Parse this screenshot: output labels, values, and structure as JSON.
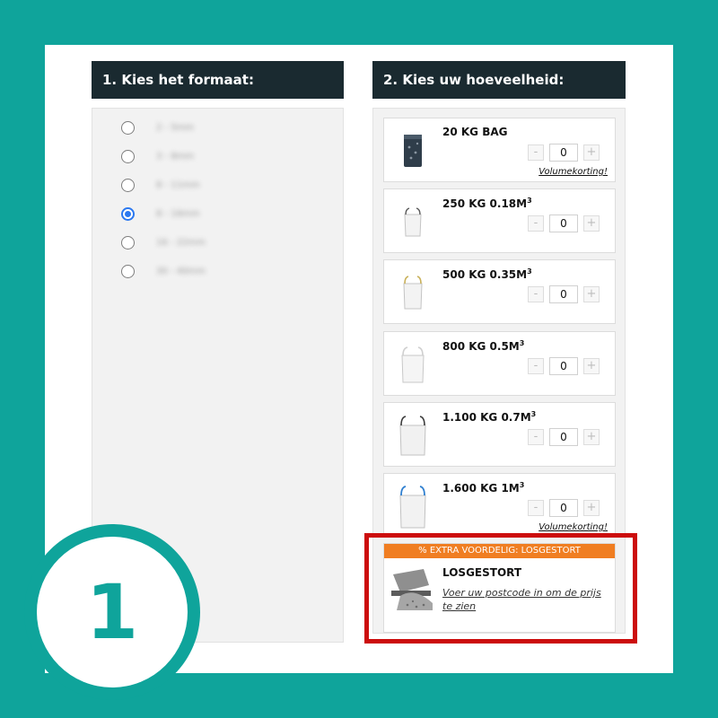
{
  "step1": {
    "title": "1. Kies het formaat:",
    "options": [
      {
        "label": "2 - 5mm",
        "selected": false
      },
      {
        "label": "3 - 8mm",
        "selected": false
      },
      {
        "label": "8 - 11mm",
        "selected": false
      },
      {
        "label": "8 - 16mm",
        "selected": true
      },
      {
        "label": "16 - 22mm",
        "selected": false
      },
      {
        "label": "30 - 40mm",
        "selected": false
      }
    ]
  },
  "step2": {
    "title": "2. Kies uw hoeveelheid:",
    "products": [
      {
        "name": "20 KG BAG",
        "sup": "",
        "qty": "0",
        "promo": "Volumekorting!",
        "icon": "bag-icon"
      },
      {
        "name": "250 KG 0.18M",
        "sup": "3",
        "qty": "0",
        "promo": "",
        "icon": "bigbag-icon"
      },
      {
        "name": "500 KG 0.35M",
        "sup": "3",
        "qty": "0",
        "promo": "",
        "icon": "bigbag-icon"
      },
      {
        "name": "800 KG 0.5M",
        "sup": "3",
        "qty": "0",
        "promo": "",
        "icon": "bigbag-icon"
      },
      {
        "name": "1.100 KG 0.7M",
        "sup": "3",
        "qty": "0",
        "promo": "",
        "icon": "bigbag-icon"
      },
      {
        "name": "1.600 KG 1M",
        "sup": "3",
        "qty": "0",
        "promo": "Volumekorting!",
        "icon": "bigbag-icon"
      }
    ],
    "minus": "-",
    "plus": "+",
    "losgestort": {
      "banner": "% EXTRA VOORDELIG: LOSGESTORT",
      "title": "LOSGESTORT",
      "link": "Voer uw postcode in om de prijs te zien",
      "icon": "dump-truck-icon"
    }
  },
  "badge": {
    "number": "1"
  },
  "colors": {
    "frame": "#0fa49b",
    "header": "#1a2a30",
    "banner": "#f07e22",
    "highlight": "#cc0d0d",
    "radio": "#2b78f0"
  }
}
